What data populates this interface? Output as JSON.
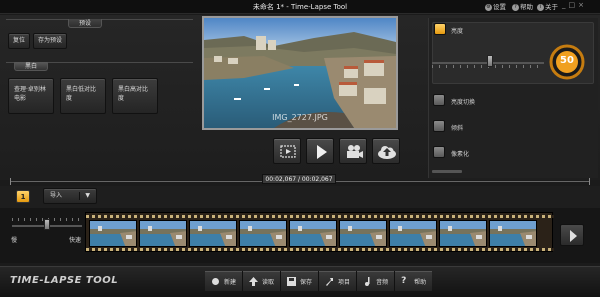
{
  "window": {
    "title": "未命名 1* - Time-Lapse Tool",
    "settings": "设置",
    "help": "帮助",
    "about": "关于",
    "settings_icon": "gear-icon",
    "help_icon": "question-icon",
    "about_icon": "info-icon"
  },
  "presets": {
    "header": "预设",
    "reset": "复位",
    "save_preset": "存为预设"
  },
  "bw": {
    "header": "黑白",
    "old_film": "查理·卓别林电影",
    "low_contrast": "黑白低对比度",
    "high_contrast": "黑白高对比度"
  },
  "preview": {
    "filename": "IMG_2727.JPG"
  },
  "controls": {
    "crop_icon": "crop-frame-icon",
    "play_icon": "play-icon",
    "camera_icon": "video-camera-icon",
    "upload_icon": "cloud-upload-icon"
  },
  "right": {
    "brightness": "亮度",
    "brightness_value": "50",
    "crossfade": "亮度切换",
    "tilt": "倾斜",
    "pixelate": "像素化"
  },
  "timeline": {
    "time": "00:02,067 / 00:02,067",
    "count": "1",
    "import": "导入",
    "slow": "慢",
    "fast": "快速",
    "frames": 9
  },
  "footer": {
    "logo": "TIME-LAPSE TOOL",
    "new": "新建",
    "load": "读取",
    "save": "保存",
    "project": "项目",
    "audio": "音频",
    "help": "帮助"
  },
  "colors": {
    "accent": "#f0a020",
    "sky": "#6e9fcf",
    "sea": "#3e7fa8"
  }
}
